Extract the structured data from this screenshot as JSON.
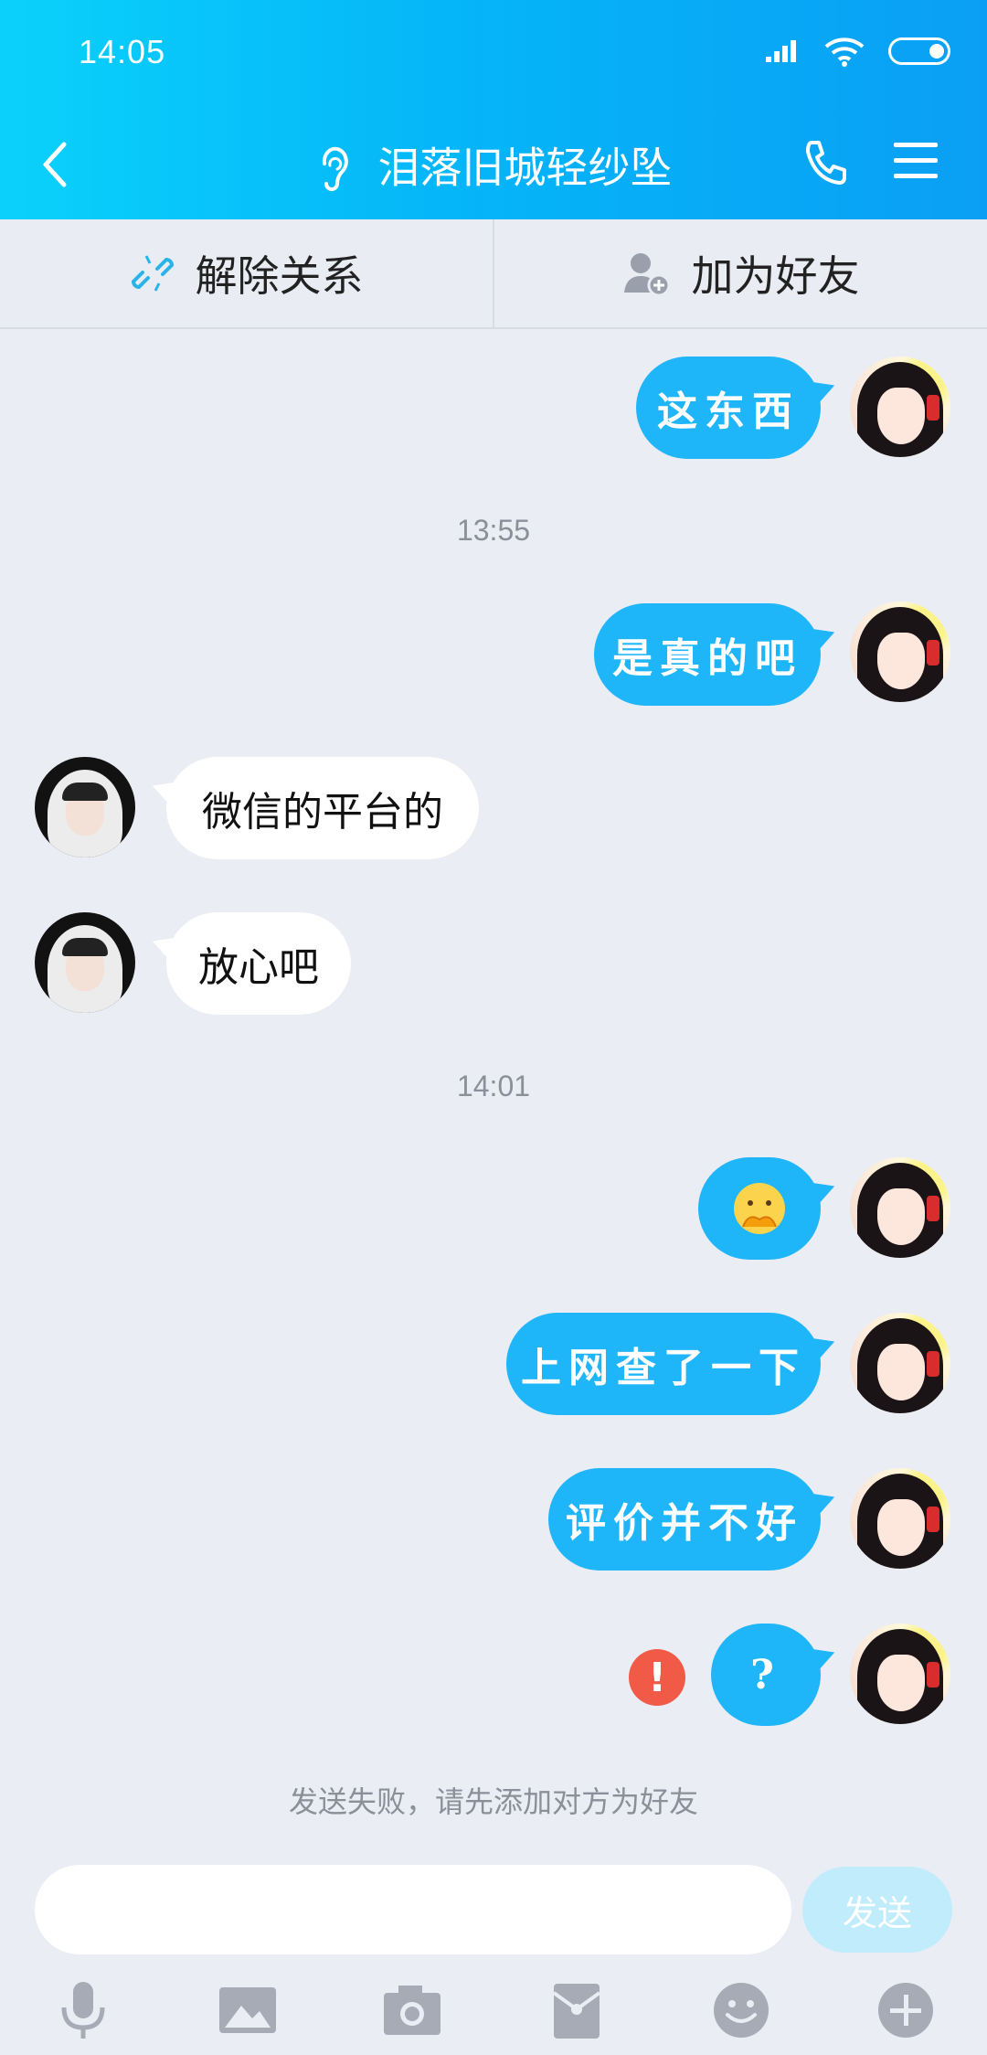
{
  "status_bar": {
    "time": "14:05"
  },
  "header": {
    "title": "泪落旧城轻纱坠"
  },
  "action_bar": {
    "unlink_label": "解除关系",
    "add_friend_label": "加为好友"
  },
  "messages": [
    {
      "side": "sent",
      "text": "这东西"
    },
    {
      "side": "time",
      "text": "13:55"
    },
    {
      "side": "sent",
      "text": "是真的吧"
    },
    {
      "side": "received",
      "text": "微信的平台的"
    },
    {
      "side": "received",
      "text": "放心吧"
    },
    {
      "side": "time",
      "text": "14:01"
    },
    {
      "side": "sent",
      "text": "",
      "emoji": "shy-emoji"
    },
    {
      "side": "sent",
      "text": "上网查了一下"
    },
    {
      "side": "sent",
      "text": "评价并不好"
    },
    {
      "side": "sent",
      "text": "?",
      "status": "failed"
    }
  ],
  "fail_notice": "发送失败，请先添加对方为好友",
  "input": {
    "value": "",
    "send_label": "发送"
  },
  "toolbar": [
    "microphone-icon",
    "image-icon",
    "camera-icon",
    "red-packet-icon",
    "emoji-icon",
    "plus-icon"
  ],
  "colors": {
    "header_start": "#0ad1fb",
    "header_end": "#0a9ff4",
    "sent_bubble": "#1fb5f9",
    "error": "#f15a47"
  }
}
